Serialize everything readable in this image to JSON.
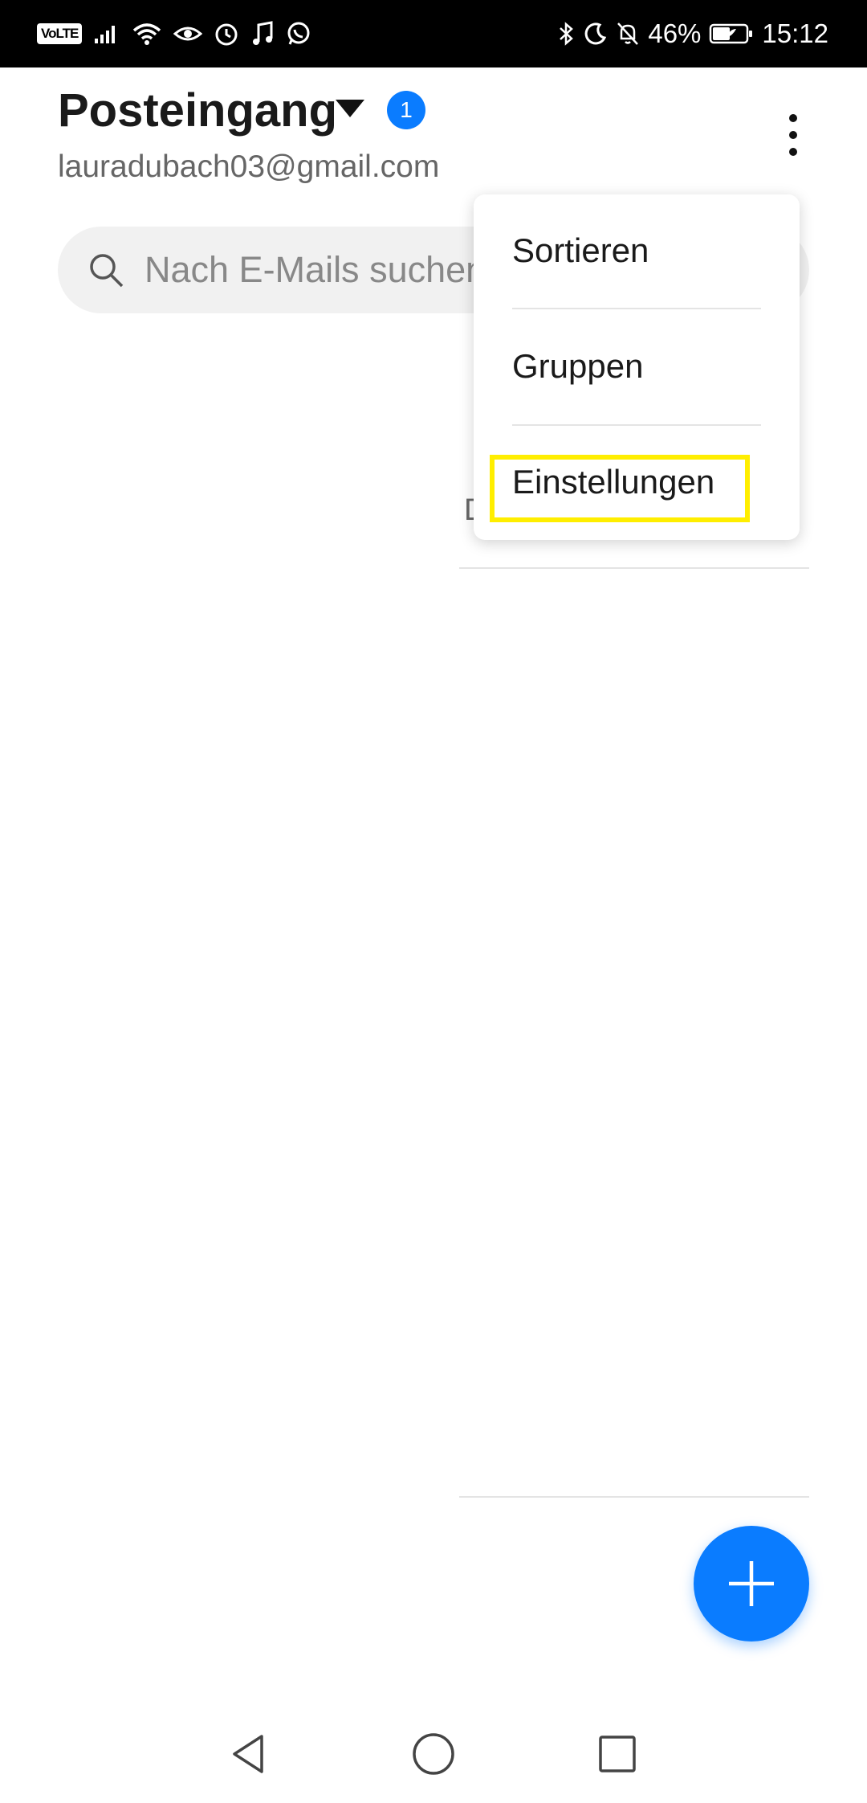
{
  "status_bar": {
    "network_badge": "VoLTE",
    "battery_percent": "46%",
    "time": "15:12",
    "left_icons": [
      "signal-icon",
      "wifi-icon",
      "eye-icon",
      "alarm-icon",
      "music-icon",
      "whatsapp-icon"
    ],
    "right_icons": [
      "bluetooth-icon",
      "moon-icon",
      "bell-off-icon",
      "battery-icon"
    ]
  },
  "header": {
    "title": "Posteingang",
    "unread_badge": "1",
    "account_email": "lauradubach03@gmail.com"
  },
  "search": {
    "placeholder": "Nach E-Mails suchen"
  },
  "background_list": {
    "partial_char": "D"
  },
  "menu": {
    "items": [
      {
        "label": "Sortieren"
      },
      {
        "label": "Gruppen"
      },
      {
        "label": "Einstellungen",
        "highlighted": true
      }
    ],
    "highlight_color": "#ffee00"
  },
  "colors": {
    "accent": "#0a7cff",
    "status_bar_bg": "#000000"
  },
  "nav_bar": {
    "buttons": [
      "back-icon",
      "home-icon",
      "recents-icon"
    ]
  }
}
